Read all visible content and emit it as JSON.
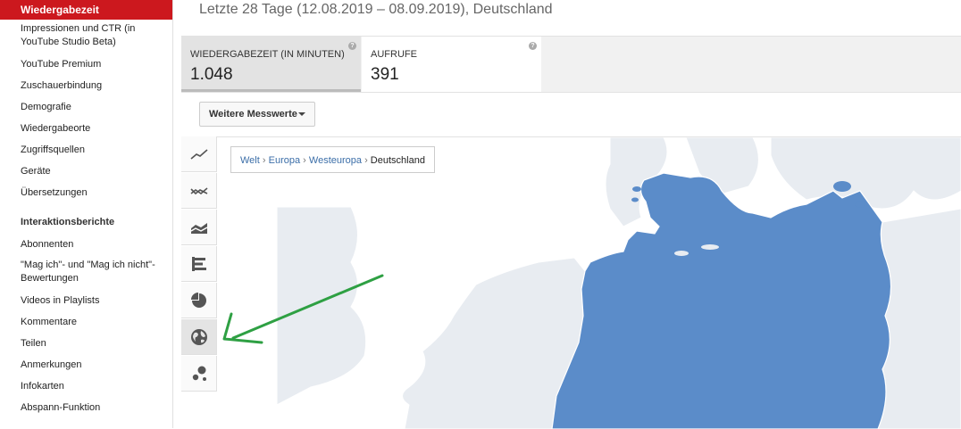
{
  "sidebar": {
    "active_item": "Wiedergabezeit",
    "items": [
      "Impressionen und CTR (in YouTube Studio Beta)",
      "YouTube Premium",
      "Zuschauerbindung",
      "Demografie",
      "Wiedergabeorte",
      "Zugriffsquellen",
      "Geräte",
      "Übersetzungen"
    ],
    "interaction_heading": "Interaktionsberichte",
    "interaction_items": [
      "Abonnenten",
      "\"Mag ich\"- und \"Mag ich nicht\"-Bewertungen",
      "Videos in Playlists",
      "Kommentare",
      "Teilen",
      "Anmerkungen",
      "Infokarten",
      "Abspann-Funktion"
    ]
  },
  "header": {
    "title": "Letzte 28 Tage (12.08.2019 – 08.09.2019), Deutschland"
  },
  "metrics": [
    {
      "label": "WIEDERGABEZEIT (IN MINUTEN)",
      "value": "1.048",
      "help": "?"
    },
    {
      "label": "AUFRUFE",
      "value": "391",
      "help": "?"
    }
  ],
  "more_metrics_label": "Weitere Messwerte",
  "chart_types": [
    "line-chart-icon",
    "multi-line-chart-icon",
    "stacked-area-chart-icon",
    "bar-chart-icon",
    "pie-chart-icon",
    "globe-map-icon",
    "bubble-chart-icon"
  ],
  "active_chart_type": "globe-map-icon",
  "breadcrumb": {
    "items": [
      "Welt",
      "Europa",
      "Westeuropa"
    ],
    "current": "Deutschland",
    "separator": "›"
  },
  "colors": {
    "active_nav": "#cc181e",
    "map_highlight": "#5b8cc9",
    "map_land": "#e8ecf1",
    "map_water": "#ffffff",
    "annotation_arrow": "#2ea043"
  }
}
